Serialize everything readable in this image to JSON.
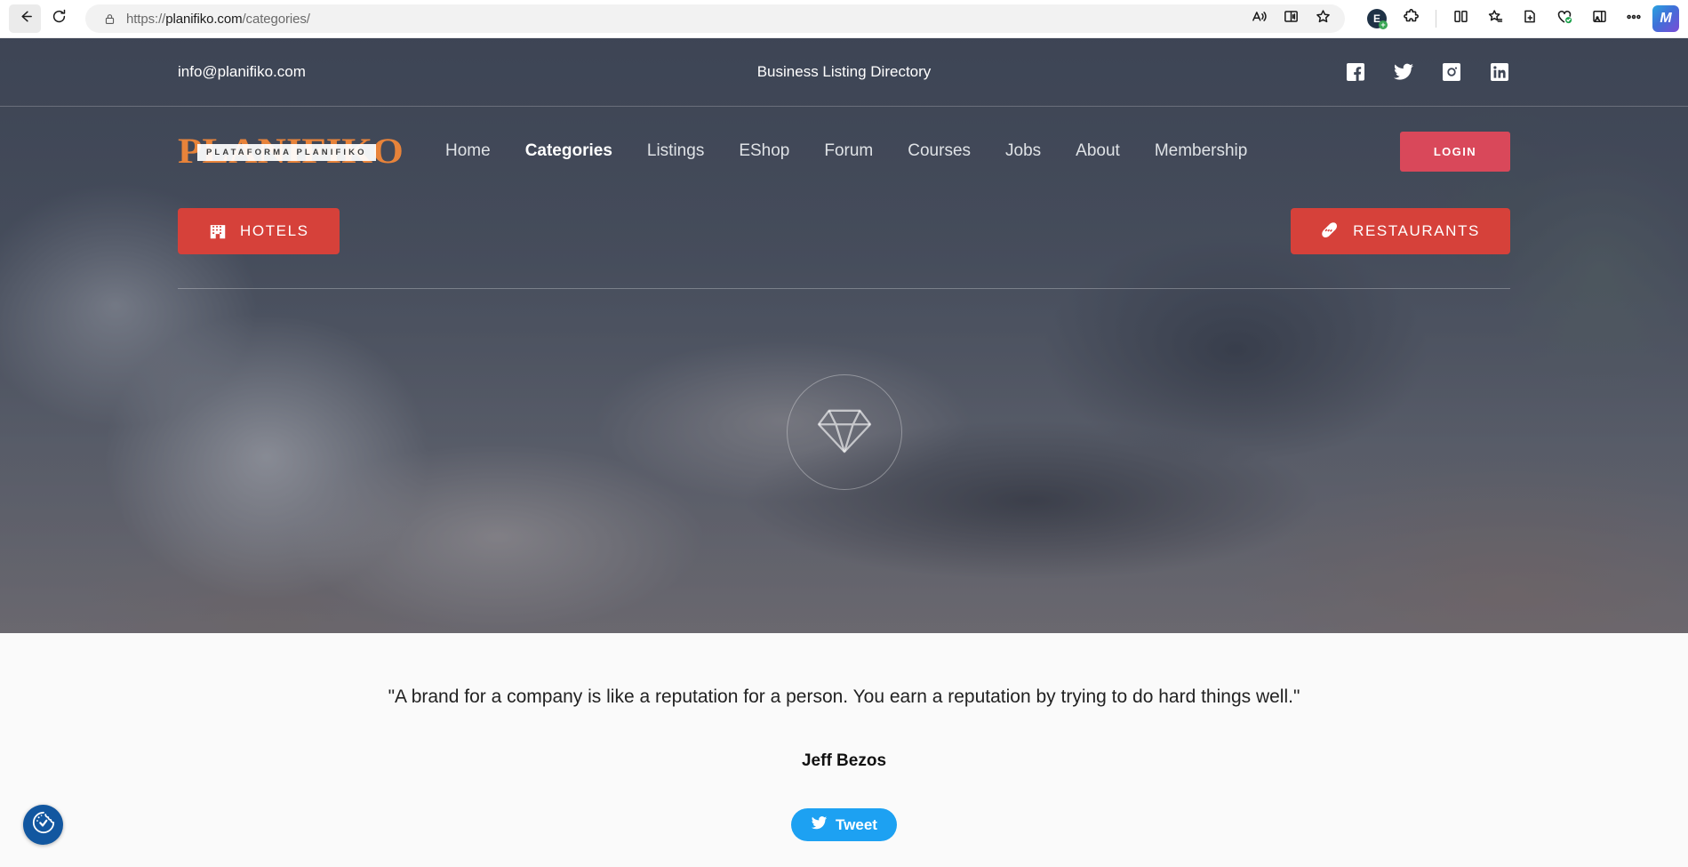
{
  "browser": {
    "url_prefix": "https://",
    "url_domain": "planifiko.com",
    "url_path": "/categories/",
    "back_icon": "back-arrow-icon",
    "reload_icon": "reload-icon",
    "lock_icon": "lock-icon",
    "read_aloud_icon": "read-aloud-icon",
    "immersive_reader_icon": "immersive-reader-icon",
    "favorite_icon": "star-icon",
    "extension_badge_label": "E",
    "extensions_icon": "puzzle-icon",
    "split_screen_icon": "split-screen-icon",
    "collections_icon": "collections-star-icon",
    "add_collection_icon": "add-to-collection-icon",
    "browser_essentials_icon": "heart-check-icon",
    "sidebar_icon": "sidebar-icon",
    "settings_more_icon": "more-options-icon",
    "copilot_icon": "copilot-icon"
  },
  "site": {
    "topbar": {
      "email": "info@planifiko.com",
      "tagline": "Business Listing Directory",
      "socials": [
        {
          "name": "facebook-icon"
        },
        {
          "name": "twitter-icon"
        },
        {
          "name": "instagram-icon"
        },
        {
          "name": "linkedin-icon"
        }
      ]
    },
    "logo": {
      "word": "PLANIFIKO",
      "subtitle": "PLATAFORMA PLANIFIKO",
      "color": "#e8833a"
    },
    "nav": [
      {
        "label": "Home",
        "active": false
      },
      {
        "label": "Categories",
        "active": true
      },
      {
        "label": "Listings",
        "active": false
      },
      {
        "label": "EShop",
        "active": false
      },
      {
        "label": "Forum",
        "active": false
      },
      {
        "label": "Courses",
        "active": false
      },
      {
        "label": "Jobs",
        "active": false
      },
      {
        "label": "About",
        "active": false
      },
      {
        "label": "Membership",
        "active": false
      }
    ],
    "login_label": "LOGIN",
    "login_color": "#d9485a",
    "categories": [
      {
        "label": "HOTELS",
        "icon": "hotel-icon",
        "color": "#d6413a"
      },
      {
        "label": "RESTAURANTS",
        "icon": "food-icon",
        "color": "#d6413a"
      }
    ],
    "watermark_icon": "diamond-icon",
    "quote": {
      "text": "\"A brand for a company is like a reputation for a person. You earn a reputation by trying to do hard things well.\"",
      "author": "Jeff Bezos",
      "tweet_label": "Tweet",
      "tweet_color": "#1da1f2",
      "tweet_icon": "twitter-bird-icon"
    },
    "accessibility_widget_icon": "accessibility-cookie-icon"
  }
}
